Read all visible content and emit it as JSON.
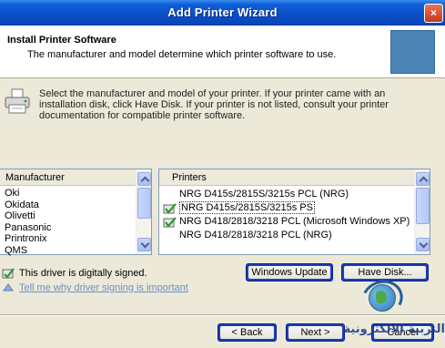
{
  "window": {
    "title": "Add Printer Wizard",
    "close_glyph": "×"
  },
  "header": {
    "title": "Install Printer Software",
    "subtitle": "The manufacturer and model determine which printer software to use."
  },
  "instructions": "Select the manufacturer and model of your printer. If your printer came with an installation disk, click Have Disk. If your printer is not listed, consult your printer documentation for compatible printer software.",
  "manufacturers": {
    "header": "Manufacturer",
    "items": [
      "Oki",
      "Okidata",
      "Olivetti",
      "Panasonic",
      "Printronix",
      "QMS"
    ]
  },
  "printers": {
    "header": "Printers",
    "items": [
      {
        "label": "NRG D415s/2815S/3215s PCL (NRG)",
        "icon": "none",
        "selected": false
      },
      {
        "label": "NRG D415s/2815S/3215s PS",
        "icon": "signed-driver-icon",
        "selected": true
      },
      {
        "label": "NRG D418/2818/3218 PCL (Microsoft Windows XP)",
        "icon": "signed-driver-icon",
        "selected": false
      },
      {
        "label": "NRG D418/2818/3218 PCL (NRG)",
        "icon": "none",
        "selected": false
      }
    ]
  },
  "signing": {
    "status": "This driver is digitally signed.",
    "link": "Tell me why driver signing is important"
  },
  "buttons": {
    "windows_update": "Windows Update",
    "have_disk": "Have Disk...",
    "back": "< Back",
    "next": "Next >",
    "cancel": "Cancel"
  },
  "watermark": {
    "text": "التربية الالكترونية"
  },
  "colors": {
    "titlebar": "#0a4ec6",
    "selected_item_bg": "#ffffff",
    "link": "#6b8fc9",
    "header_image": "#4a83b4"
  }
}
